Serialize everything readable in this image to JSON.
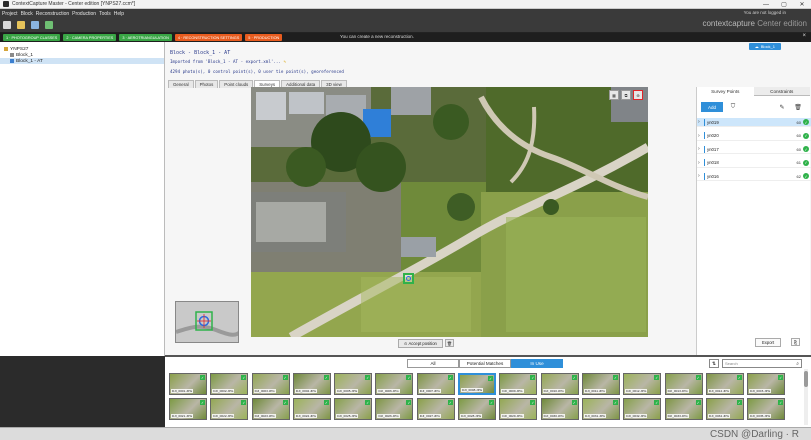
{
  "window": {
    "title": "ContextCapture Master - Center edition [YNPS27.ccm*]",
    "controls": [
      "—",
      "▢",
      "✕"
    ]
  },
  "menu": {
    "items": [
      "Project",
      "Block",
      "Reconstruction",
      "Production",
      "Tools",
      "Help"
    ],
    "user_text": "You are not logged in"
  },
  "brand": {
    "name": "contextcapture",
    "edition": "Center edition"
  },
  "steps": {
    "items": [
      {
        "label": "1 · PHOTOGROUP CLASSES",
        "color": "#39a645"
      },
      {
        "label": "2 · CAMERA PROPERTIES",
        "color": "#39a645"
      },
      {
        "label": "3 · AEROTRIANGULATION",
        "color": "#39a645"
      },
      {
        "label": "4 · RECONSTRUCTION SETTINGS",
        "color": "#e85c1f"
      },
      {
        "label": "5 · PRODUCTION",
        "color": "#e85c1f"
      }
    ],
    "notice": "You can create a new reconstruction."
  },
  "tree": {
    "project": "YNPS27",
    "block": "Block_1",
    "block_at": "Block_1 - AT"
  },
  "main": {
    "cloud_link": "Block_1",
    "block_title": "Block - Block_1 - AT",
    "imported": "Imported from 'Block_1 - AT - export.xml'...",
    "stats": "4294 photo(s), 0 control point(s), 0 user tie point(s), georeferenced",
    "tabs": [
      "General",
      "Photos",
      "Point clouds",
      "Surveys",
      "Additional data",
      "3D view"
    ],
    "active_tab": 3
  },
  "viewer": {
    "tool_icons": [
      "grid-icon",
      "copy-icon",
      "zoom-icon"
    ],
    "accept_label": "Accept position"
  },
  "survey": {
    "tabs": [
      "Survey Points",
      "Constraints"
    ],
    "add_label": "Add",
    "points": [
      {
        "name": "yn019",
        "count": "60",
        "selected": true
      },
      {
        "name": "yn020",
        "count": "60",
        "selected": false
      },
      {
        "name": "yn017",
        "count": "60",
        "selected": false
      },
      {
        "name": "yn018",
        "count": "61",
        "selected": false
      },
      {
        "name": "yn016",
        "count": "62",
        "selected": false
      }
    ],
    "export_label": "Export"
  },
  "bottom": {
    "filters": [
      "All",
      "Potential Matches",
      "In Use"
    ],
    "active_filter": 2,
    "search_placeholder": "Search",
    "row1": [
      "DJI_0001.JPG",
      "DJI_0002.JPG",
      "DJI_0003.JPG",
      "DJI_0004.JPG",
      "DJI_0005.JPG",
      "DJI_0006.JPG",
      "DJI_0007.JPG",
      "DJI_0008.JPG",
      "DJI_0009.JPG",
      "DJI_0010.JPG",
      "DJI_0011.JPG",
      "DJI_0012.JPG",
      "DJI_0013.JPG",
      "DJI_0014.JPG",
      "DJI_0015.JPG"
    ],
    "row2": [
      "DJI_0021.JPG",
      "DJI_0022.JPG",
      "DJI_0023.JPG",
      "DJI_0024.JPG",
      "DJI_0025.JPG",
      "DJI_0026.JPG",
      "DJI_0027.JPG",
      "DJI_0028.JPG",
      "DJI_0029.JPG",
      "DJI_0030.JPG",
      "DJI_0031.JPG",
      "DJI_0032.JPG",
      "DJI_0033.JPG",
      "DJI_0034.JPG",
      "DJI_0035.JPG"
    ]
  },
  "watermark": "CSDN @Darling · R"
}
